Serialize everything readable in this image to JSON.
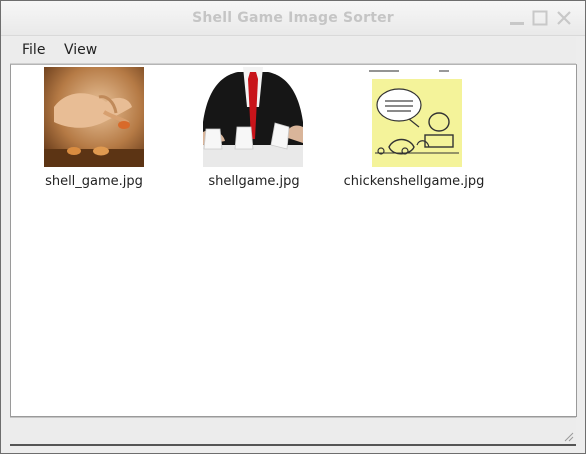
{
  "window": {
    "title": "Shell Game Image Sorter"
  },
  "menu": {
    "items": [
      {
        "label": "File"
      },
      {
        "label": "View"
      }
    ]
  },
  "images": [
    {
      "filename": "shell_game.jpg",
      "thumbnail": "hand-with-shells-photo"
    },
    {
      "filename": "shellgame.jpg",
      "thumbnail": "man-in-suit-with-cups-photo"
    },
    {
      "filename": "chickenshellgame.jpg",
      "thumbnail": "chicken-cartoon-sticky-note"
    }
  ],
  "status": {
    "text": ""
  },
  "colors": {
    "title_text": "#c5c5c5",
    "window_bg": "#ededed",
    "content_bg": "#ffffff",
    "sticky_note": "#f4f39a"
  }
}
